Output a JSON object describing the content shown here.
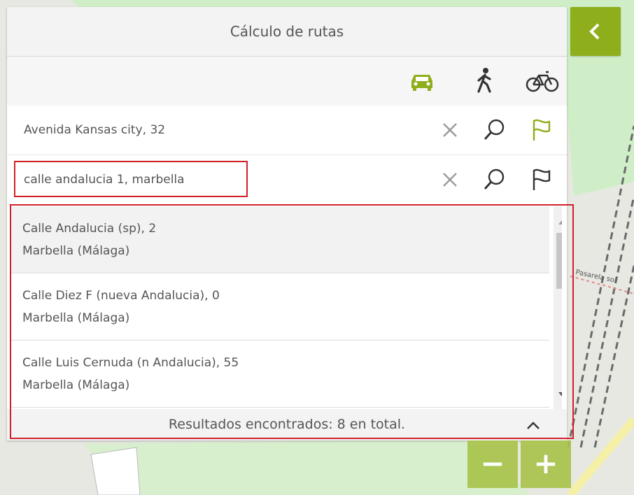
{
  "panel": {
    "title": "Cálculo de rutas",
    "collapse_icon": "chevron-left-icon",
    "modes": [
      {
        "name": "car",
        "icon": "car-icon",
        "active": true
      },
      {
        "name": "walk",
        "icon": "walking-icon",
        "active": false
      },
      {
        "name": "bike",
        "icon": "bicycle-icon",
        "active": false
      }
    ],
    "origin": {
      "value": "Avenida Kansas city, 32"
    },
    "destination": {
      "value": "calle andalucia 1, marbella"
    }
  },
  "results": {
    "items": [
      {
        "line1": "Calle Andalucia (sp), 2",
        "line2": "Marbella (Málaga)"
      },
      {
        "line1": "Calle Diez F (nueva Andalucia), 0",
        "line2": "Marbella (Málaga)"
      },
      {
        "line1": "Calle Luis Cernuda (n Andalucia), 55",
        "line2": "Marbella (Málaga)"
      }
    ],
    "summary": "Resultados encontrados: 8 en total.",
    "collapse_icon": "chevron-up-icon"
  },
  "map": {
    "zoom_out_label": "−",
    "zoom_in_label": "+",
    "street_label": "Pasarela sol"
  },
  "colors": {
    "accent": "#8fae1b",
    "highlight": "#d0202a",
    "text": "#555555"
  }
}
